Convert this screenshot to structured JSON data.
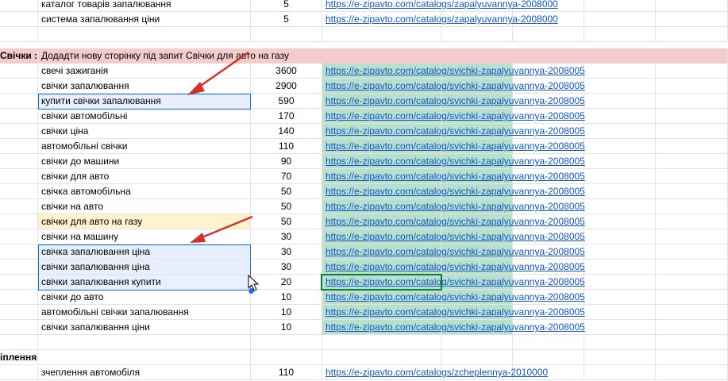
{
  "sheet": {
    "top_rows": [
      {
        "keyword": "каталог товарів запалювання",
        "volume": "5",
        "url": "https://e-zipavto.com/catalogs/zapalyuvannya-2008000"
      },
      {
        "keyword": "система запалювання ціни",
        "volume": "5",
        "url": "https://e-zipavto.com/catalogs/zapalyuvannya-2008000"
      }
    ],
    "section_header": {
      "label": "Свічки :",
      "note": "Додадти нову сторінку під запит Свічки для авто на газу"
    },
    "svichki_rows": [
      {
        "keyword": "свечі зажиганія",
        "volume": "3600",
        "url": "https://e-zipavto.com/catalog/svichki-zapalyuvannya-2008005"
      },
      {
        "keyword": "свічки запалювання",
        "volume": "2900",
        "url": "https://e-zipavto.com/catalog/svichki-zapalyuvannya-2008005"
      },
      {
        "keyword": "купити свічки запалювання",
        "volume": "590",
        "url": "https://e-zipavto.com/catalog/svichki-zapalyuvannya-2008005"
      },
      {
        "keyword": "свічки автомобільні",
        "volume": "170",
        "url": "https://e-zipavto.com/catalog/svichki-zapalyuvannya-2008005"
      },
      {
        "keyword": "свічки ціна",
        "volume": "140",
        "url": "https://e-zipavto.com/catalog/svichki-zapalyuvannya-2008005"
      },
      {
        "keyword": "автомобільні свічки",
        "volume": "110",
        "url": "https://e-zipavto.com/catalog/svichki-zapalyuvannya-2008005"
      },
      {
        "keyword": "свічки до машини",
        "volume": "90",
        "url": "https://e-zipavto.com/catalog/svichki-zapalyuvannya-2008005"
      },
      {
        "keyword": "свічки для авто",
        "volume": "70",
        "url": "https://e-zipavto.com/catalog/svichki-zapalyuvannya-2008005"
      },
      {
        "keyword": "свічка автомобільна",
        "volume": "50",
        "url": "https://e-zipavto.com/catalog/svichki-zapalyuvannya-2008005"
      },
      {
        "keyword": "свічки на авто",
        "volume": "50",
        "url": "https://e-zipavto.com/catalog/svichki-zapalyuvannya-2008005"
      },
      {
        "keyword": "свічки для авто на газу",
        "volume": "50",
        "url": "https://e-zipavto.com/catalog/svichki-zapalyuvannya-2008005"
      },
      {
        "keyword": "свічки на машину",
        "volume": "30",
        "url": "https://e-zipavto.com/catalog/svichki-zapalyuvannya-2008005"
      },
      {
        "keyword": "свічка запалювання ціна",
        "volume": "30",
        "url": "https://e-zipavto.com/catalog/svichki-zapalyuvannya-2008005"
      },
      {
        "keyword": "свічки запалювання ціна",
        "volume": "30",
        "url": "https://e-zipavto.com/catalog/svichki-zapalyuvannya-2008005"
      },
      {
        "keyword": "свічки запалювання купити",
        "volume": "20",
        "url": "https://e-zipavto.com/catalog/svichki-zapalyuvannya-2008005"
      },
      {
        "keyword": "свічки до авто",
        "volume": "10",
        "url": "https://e-zipavto.com/catalog/svichki-zapalyuvannya-2008005"
      },
      {
        "keyword": "автомобільні свічки запалювання",
        "volume": "10",
        "url": "https://e-zipavto.com/catalog/svichki-zapalyuvannya-2008005"
      },
      {
        "keyword": "свічки запалювання ціни",
        "volume": "10",
        "url": "https://e-zipavto.com/catalog/svichki-zapalyuvannya-2008005"
      }
    ],
    "second_section_label": "іплення",
    "bottom_rows": [
      {
        "keyword": "зчеплення автомобіля",
        "volume": "110",
        "url": "https://e-zipavto.com/catalogs/zcheplennya-2010000"
      }
    ]
  },
  "colors": {
    "header_fill": "#f4cccc",
    "url_fill": "#b7e1cd",
    "selection_fill": "#e8f0fe",
    "highlight_fill": "#fff2cc",
    "arrow": "#d32f2f",
    "link": "#1155cc"
  },
  "icons": [
    "red-arrow-icon",
    "mouse-cursor-icon"
  ]
}
